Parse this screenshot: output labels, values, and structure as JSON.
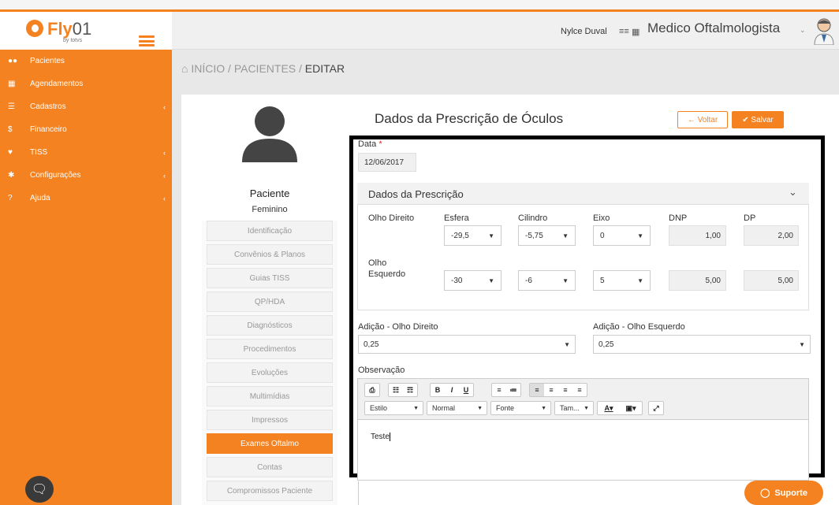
{
  "brand": {
    "name": "Fly",
    "suffix": "01",
    "sub": "by totvs"
  },
  "header": {
    "user": "Nylce Duval",
    "role": "Medico Oftalmologista"
  },
  "sidebar": {
    "items": [
      {
        "label": "Pacientes",
        "icon": "users-icon"
      },
      {
        "label": "Agendamentos",
        "icon": "calendar-icon"
      },
      {
        "label": "Cadastros",
        "icon": "list-icon"
      },
      {
        "label": "Financeiro",
        "icon": "dollar-icon"
      },
      {
        "label": "TISS",
        "icon": "heartbeat-icon"
      },
      {
        "label": "Configurações",
        "icon": "gear-icon"
      },
      {
        "label": "Ajuda",
        "icon": "question-icon"
      }
    ]
  },
  "breadcrumb": {
    "home": "INÍCIO",
    "sep1": "/",
    "pacientes": "PACIENTES",
    "sep2": "/",
    "current": "EDITAR"
  },
  "patient": {
    "name": "Paciente",
    "sex": "Feminino"
  },
  "tabs": [
    "Identificação",
    "Convênios & Planos",
    "Guias TISS",
    "QP/HDA",
    "Diagnósticos",
    "Procedimentos",
    "Evoluções",
    "Multimídias",
    "Impressos",
    "Exames Oftalmo",
    "Contas",
    "Compromissos Paciente"
  ],
  "form": {
    "title": "Dados da Prescrição de Óculos",
    "voltar": "Voltar",
    "salvar": "Salvar",
    "date_label": "Data",
    "date_req": "*",
    "date_value": "12/06/2017",
    "section_title": "Dados da Prescrição",
    "cols": {
      "esfera": "Esfera",
      "cilindro": "Cilindro",
      "eixo": "Eixo",
      "dnp": "DNP",
      "dp": "DP"
    },
    "od_label": "Olho Direito",
    "oe_label_1": "Olho",
    "oe_label_2": "Esquerdo",
    "od": {
      "esfera": "-29,5",
      "cilindro": "-5,75",
      "eixo": "0",
      "dnp": "1,00",
      "dp": "2,00"
    },
    "oe": {
      "esfera": "-30",
      "cilindro": "-6",
      "eixo": "5",
      "dnp": "5,00",
      "dp": "5,00"
    },
    "adicao_od_label": "Adição - Olho Direito",
    "adicao_od_value": "0,25",
    "adicao_oe_label": "Adição - Olho Esquerdo",
    "adicao_oe_value": "0,25",
    "obs_label": "Observação",
    "obs_text": "Teste"
  },
  "editor_toolbar": {
    "estilo": "Estilo",
    "normal": "Normal",
    "fonte": "Fonte",
    "tam": "Tam..."
  },
  "suporte": "Suporte",
  "colors": {
    "accent": "#f58220",
    "frame": "#000000"
  }
}
